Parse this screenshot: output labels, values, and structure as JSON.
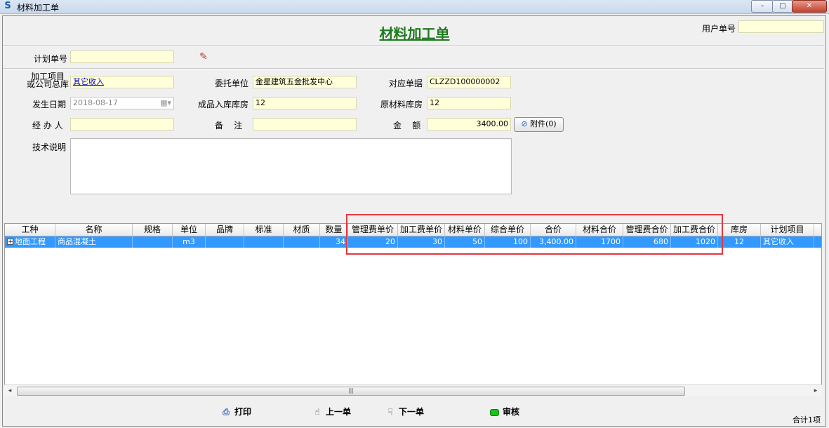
{
  "window": {
    "title": "材料加工单",
    "minimize": "–",
    "maximize": "□",
    "close": "✕"
  },
  "form": {
    "title": "材料加工单",
    "user_no_label": "用户单号",
    "user_no_value": "",
    "plan_no_label": "计划单号",
    "plan_no_value": "",
    "project_label_line1": "加工项目",
    "project_label_line2": "或公司总库",
    "project_value": "其它收入",
    "client_label": "委托单位",
    "client_value": "金星建筑五金批发中心",
    "ref_doc_label": "对应单据",
    "ref_doc_value": "CLZZD100000002",
    "date_label": "发生日期",
    "date_value": "2018-08-17",
    "product_store_label": "成品入库库房",
    "product_store_value": "12",
    "raw_store_label": "原材料库房",
    "raw_store_value": "12",
    "handler_label": "经 办 人",
    "handler_value": "",
    "remark_label": "备    注",
    "remark_value": "",
    "amount_label": "金    额",
    "amount_value": "3400.00",
    "attach_label": "附件(0)",
    "tech_label": "技术说明",
    "tech_value": ""
  },
  "grid": {
    "columns": [
      "工种",
      "名称",
      "规格",
      "单位",
      "品牌",
      "标准",
      "材质",
      "数量",
      "管理费单价",
      "加工费单价",
      "材料单价",
      "综合单价",
      "合价",
      "材料合价",
      "管理费合价",
      "加工费合价",
      "库房",
      "计划项目"
    ],
    "rows": [
      [
        "地面工程",
        "商品混凝土",
        "",
        "m3",
        "",
        "",
        "",
        "34",
        "20",
        "30",
        "50",
        "100",
        "3,400.00",
        "1700",
        "680",
        "1020",
        "12",
        "其它收入"
      ]
    ]
  },
  "toolbar": {
    "print": "打印",
    "prev": "上一单",
    "next": "下一单",
    "audit": "审核"
  },
  "footer": {
    "total": "合计1项"
  },
  "colors": {
    "title_green": "#1f7a1f",
    "selected_row": "#3399ff",
    "highlight_red": "#e0393e",
    "field_yellow": "#ffffd9"
  }
}
